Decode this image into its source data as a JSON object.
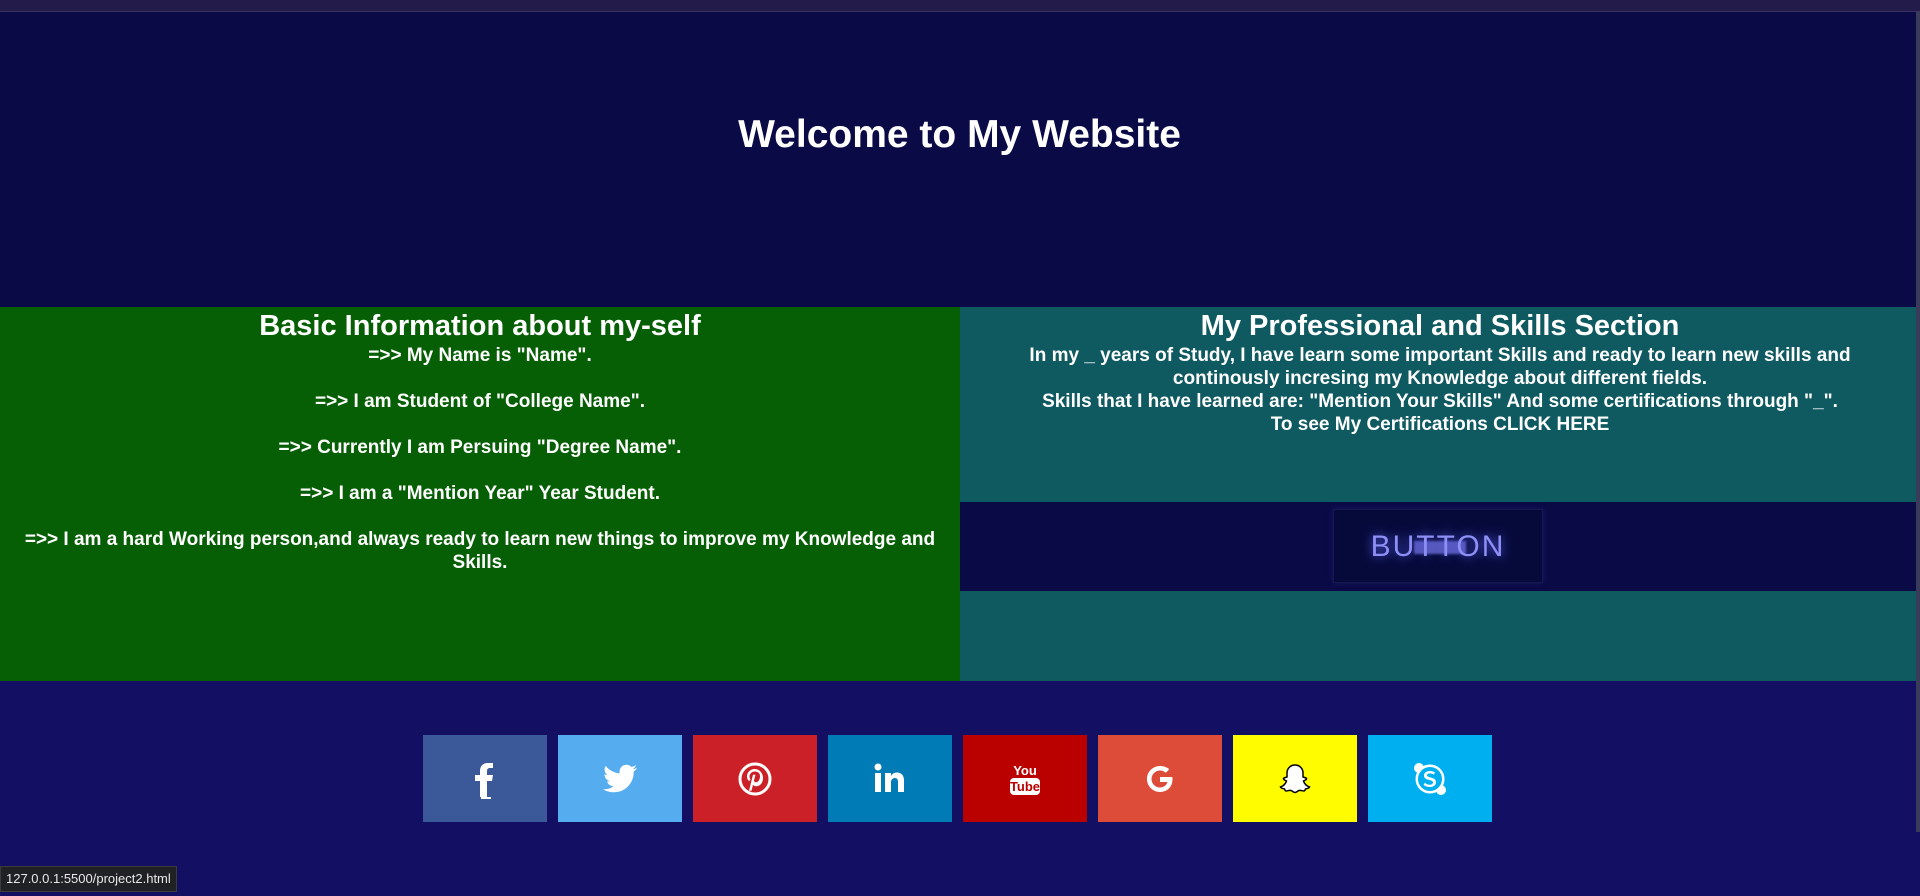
{
  "header": {
    "title": "Welcome to My Website"
  },
  "basic_info": {
    "title": "Basic Information about my-self",
    "lines": [
      "=>> My Name is \"Name\".",
      "=>> I am Student of \"College Name\".",
      "=>> Currently I am Persuing \"Degree Name\".",
      "=>> I am a \"Mention Year\" Year Student.",
      "=>> I am a hard Working person,and always ready to learn new things to improve my Knowledge and Skills."
    ]
  },
  "skills": {
    "title": "My Professional and Skills Section",
    "paragraph_1": "In my _ years of Study, I have learn some important Skills and ready to learn new skills and continously incresing my Knowledge about different fields.",
    "paragraph_2": "Skills that I have learned are: \"Mention Your Skills\" And some certifications through \"_\".",
    "paragraph_3": "To see My Certifications CLICK HERE",
    "button_label": "BUTTON"
  },
  "social": [
    {
      "name": "facebook-icon",
      "color": "#3b5998"
    },
    {
      "name": "twitter-icon",
      "color": "#55acee"
    },
    {
      "name": "pinterest-icon",
      "color": "#cb2027"
    },
    {
      "name": "linkedin-icon",
      "color": "#007bb5"
    },
    {
      "name": "youtube-icon",
      "color": "#bb0000"
    },
    {
      "name": "google-icon",
      "color": "#dd4b39"
    },
    {
      "name": "snapchat-icon",
      "color": "#fffc00"
    },
    {
      "name": "skype-icon",
      "color": "#00aff0"
    }
  ],
  "status_bar": {
    "url": "127.0.0.1:5500/project2.html"
  }
}
